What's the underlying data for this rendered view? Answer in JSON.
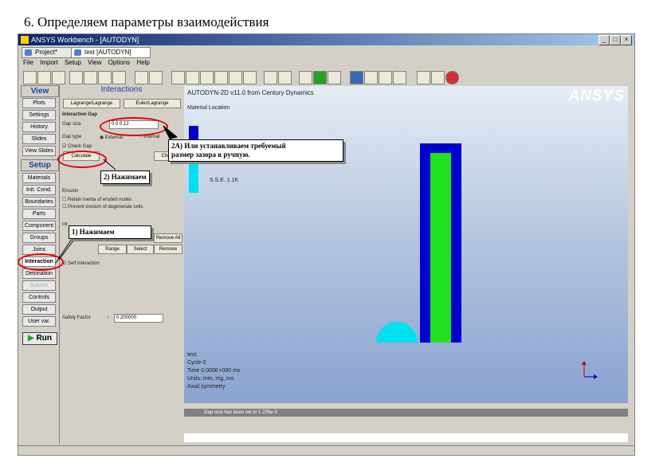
{
  "caption": "6. Определяем параметры взаимодействия",
  "window": {
    "title": "ANSYS Workbench - [AUTODYN]",
    "min": "_",
    "max": "□",
    "close": "×"
  },
  "tabs": [
    {
      "label": "Project*"
    },
    {
      "label": "test [AUTODYN]"
    }
  ],
  "menu": [
    "File",
    "Import",
    "Setup",
    "View",
    "Options",
    "Help"
  ],
  "leftnav": {
    "view_header": "View",
    "view_items": [
      "Plots",
      "Settings",
      "History",
      "Slides",
      "View Slides"
    ],
    "setup_header": "Setup",
    "setup_items": [
      "Materials",
      "Init. Cond.",
      "Boundaries",
      "Parts",
      "Component",
      "Groups",
      "Joins",
      "Interaction",
      "Detonation",
      "Solvers",
      "Controls",
      "Output",
      "User var."
    ],
    "run_label": "Run"
  },
  "panel": {
    "header": "Interactions",
    "lagrange_btn": "Lagrange/Lagrange",
    "euler_btn": "Euler/Lagrange",
    "gap_title": "Interaction Gap",
    "gap_label": "Gap size",
    "gap_value": "0.0 0.12",
    "gap_type_label": "Gap type",
    "external": "External",
    "internal": "Internal",
    "check_label": "Check Gap",
    "calculate_btn": "Calculate",
    "check_btn": "Check",
    "erosion_title": "Erosion",
    "erosion_opt1": "Retain inertia of eroded nodes",
    "erosion_opt2": "Prevent erosion of degenerate cells",
    "interactions_label": "Int",
    "remove_all": "Remove All",
    "range_btn": "Range",
    "select_btn": "Select",
    "remove_btn": "Remove",
    "self_interaction": "Self interaction",
    "safety_label": "Safety Factor",
    "safety_value": "0.200000"
  },
  "viewport": {
    "header": "AUTODYN-2D v11.0 from Century Dynamics",
    "material_location": "Material Location",
    "logo": "ANSYS",
    "marker_label": "S.S.E. 1.1K",
    "info_lines": [
      "test",
      "Cycle 0",
      "Time 0.000E+000 ms",
      "Units: mm, mg, ms",
      "Axial symmetry"
    ]
  },
  "console": {
    "message": "Gap size has been set to 1.235e-3"
  },
  "annotations": {
    "step1": "1) Нажимаем",
    "step2": "2) Нажимаем",
    "step2a_line1": "2А) Или устанавливаем требуемый",
    "step2a_line2": "размер зазора в ручную."
  },
  "colors": {
    "outer_part": "#0000cc",
    "inner_part": "#22e022",
    "cyan_part": "#00e0f0",
    "highlight_ring": "#e00000"
  }
}
